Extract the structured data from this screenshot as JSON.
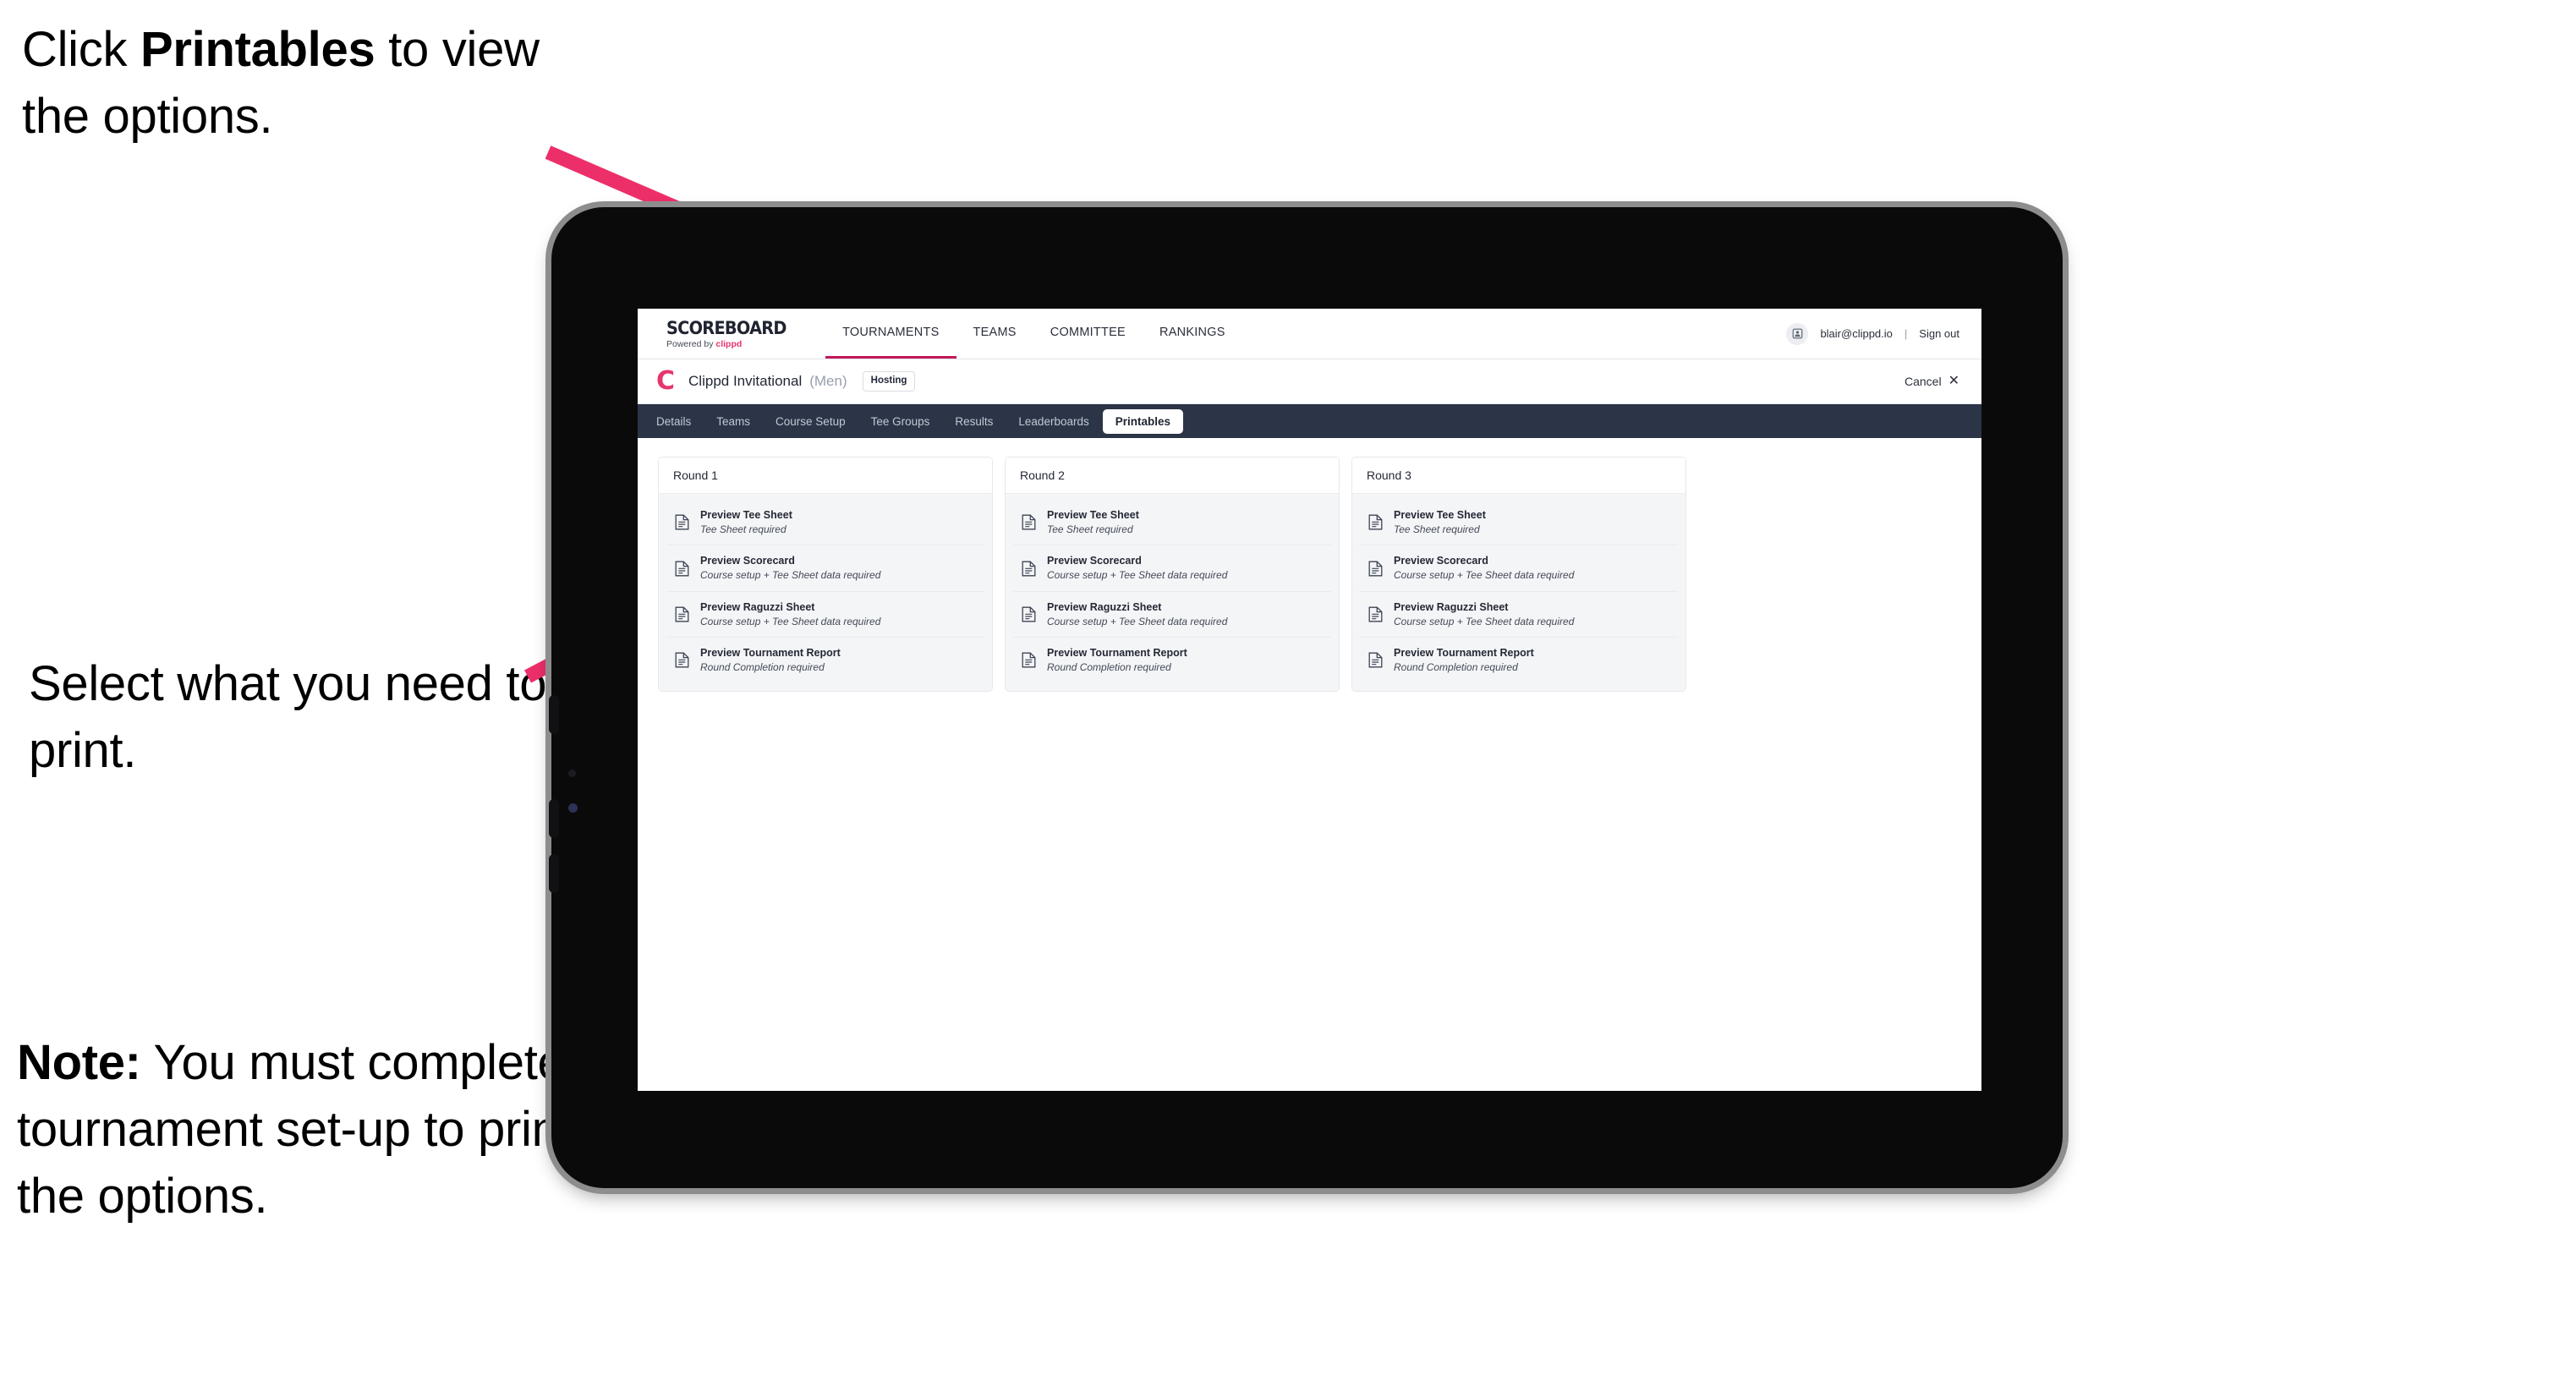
{
  "annotations": {
    "printables_hint_pre": "Click ",
    "printables_hint_bold": "Printables",
    "printables_hint_post": " to view the options.",
    "select_hint": "Select what you need to print.",
    "note_bold": "Note:",
    "note_rest": " You must complete the tournament set-up to print all the options."
  },
  "colors": {
    "accent_pink": "#e8356d",
    "arrow_pink": "#ed2f69",
    "tabstrip_navy": "#2b3547",
    "nav_underline": "#c2185b",
    "card_body_gray": "#f4f5f7"
  },
  "topnav": {
    "brand_title": "SCOREBOARD",
    "brand_sub_prefix": "Powered by ",
    "brand_sub_brand": "clippd",
    "items": [
      {
        "label": "TOURNAMENTS",
        "active": true
      },
      {
        "label": "TEAMS",
        "active": false
      },
      {
        "label": "COMMITTEE",
        "active": false
      },
      {
        "label": "RANKINGS",
        "active": false
      }
    ],
    "avatar_icon": "user-avatar-icon",
    "user_email": "blair@clippd.io",
    "divider": "|",
    "sign_out": "Sign out"
  },
  "tournament_bar": {
    "logo_mark": "C",
    "name": "Clippd Invitational",
    "gender": "(Men)",
    "status_badge": "Hosting",
    "cancel_label": "Cancel",
    "cancel_icon": "✕"
  },
  "tabs": [
    {
      "label": "Details",
      "active": false
    },
    {
      "label": "Teams",
      "active": false
    },
    {
      "label": "Course Setup",
      "active": false
    },
    {
      "label": "Tee Groups",
      "active": false
    },
    {
      "label": "Results",
      "active": false
    },
    {
      "label": "Leaderboards",
      "active": false
    },
    {
      "label": "Printables",
      "active": true
    }
  ],
  "rounds": [
    {
      "title": "Round 1",
      "items": [
        {
          "title": "Preview Tee Sheet",
          "sub": "Tee Sheet required"
        },
        {
          "title": "Preview Scorecard",
          "sub": "Course setup + Tee Sheet data required"
        },
        {
          "title": "Preview Raguzzi Sheet",
          "sub": "Course setup + Tee Sheet data required"
        },
        {
          "title": "Preview Tournament Report",
          "sub": "Round Completion required"
        }
      ]
    },
    {
      "title": "Round 2",
      "items": [
        {
          "title": "Preview Tee Sheet",
          "sub": "Tee Sheet required"
        },
        {
          "title": "Preview Scorecard",
          "sub": "Course setup + Tee Sheet data required"
        },
        {
          "title": "Preview Raguzzi Sheet",
          "sub": "Course setup + Tee Sheet data required"
        },
        {
          "title": "Preview Tournament Report",
          "sub": "Round Completion required"
        }
      ]
    },
    {
      "title": "Round 3",
      "items": [
        {
          "title": "Preview Tee Sheet",
          "sub": "Tee Sheet required"
        },
        {
          "title": "Preview Scorecard",
          "sub": "Course setup + Tee Sheet data required"
        },
        {
          "title": "Preview Raguzzi Sheet",
          "sub": "Course setup + Tee Sheet data required"
        },
        {
          "title": "Preview Tournament Report",
          "sub": "Round Completion required"
        }
      ]
    }
  ],
  "device": {
    "buttons": [
      "volume-up-button",
      "volume-down-button",
      "power-button"
    ]
  }
}
